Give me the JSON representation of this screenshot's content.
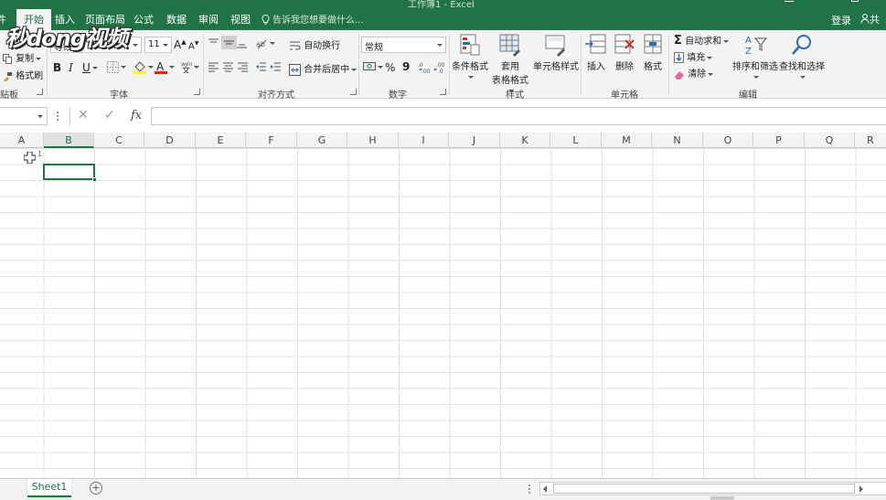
{
  "titlebar": {
    "tabs": [
      "件",
      "开始",
      "插入",
      "页面布局",
      "公式",
      "数据",
      "审阅",
      "视图"
    ],
    "active_tab": "开始",
    "tell_me": "告诉我您想要做什么...",
    "login": "登录",
    "share": "共",
    "doc_title": "工作簿1 - Excel"
  },
  "watermark": {
    "text": "秒dong视频"
  },
  "ribbon": {
    "clipboard": {
      "copy": "复制",
      "format_painter": "格式刷",
      "label": "贴板"
    },
    "font": {
      "font_name": "等线",
      "font_size": "11",
      "bold": "B",
      "italic": "I",
      "underline": "U",
      "label": "字体"
    },
    "alignment": {
      "wrap_text": "自动换行",
      "merge_center": "合并后居中",
      "label": "对齐方式"
    },
    "number": {
      "format": "常规",
      "percent": "%",
      "comma": "9",
      "label": "数字"
    },
    "styles": {
      "conditional": "条件格式",
      "format_table_1": "套用",
      "format_table_2": "表格格式",
      "cell_styles": "单元格样式",
      "label": "样式"
    },
    "cells": {
      "insert": "插入",
      "delete": "删除",
      "format": "格式",
      "label": "单元格"
    },
    "editing": {
      "autosum": "自动求和",
      "fill": "填充",
      "clear": "清除",
      "sort_filter": "排序和筛选",
      "find_select": "查找和选择",
      "label": "编辑"
    }
  },
  "formula_bar": {
    "name_box": "",
    "fx": "fx",
    "cancel": "✕",
    "enter": "✓",
    "content": ""
  },
  "grid": {
    "columns": [
      "A",
      "B",
      "C",
      "D",
      "E",
      "F",
      "G",
      "H",
      "I",
      "J",
      "K",
      "L",
      "M",
      "N",
      "O",
      "P",
      "Q",
      "R"
    ],
    "selected_column": "B",
    "row_label": "1"
  },
  "sheets": {
    "tabs": [
      "Sheet1"
    ],
    "add": "+"
  },
  "colors": {
    "accent": "#217346",
    "ribbon_bg": "#f3f3f3",
    "gridline": "#e1e1e1"
  }
}
